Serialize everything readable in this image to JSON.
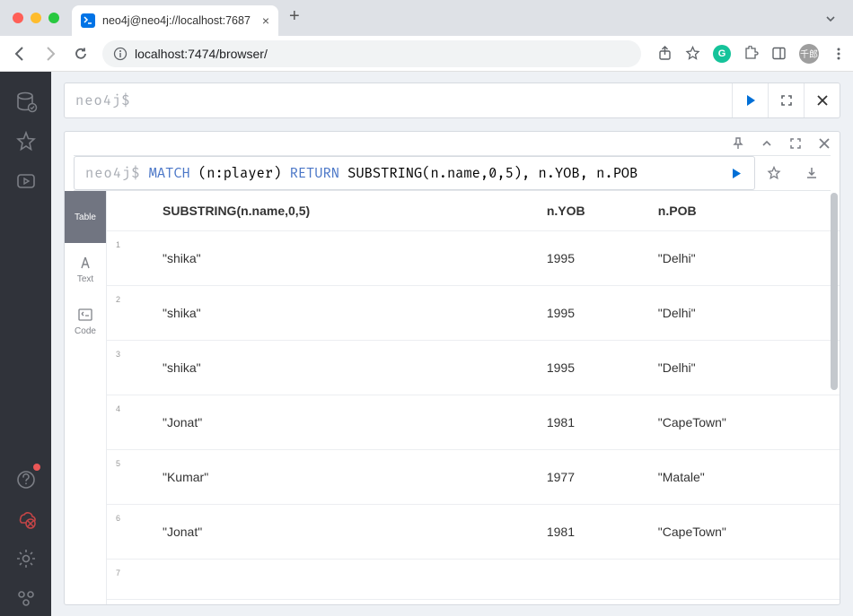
{
  "browser": {
    "tab_title": "neo4j@neo4j://localhost:7687",
    "url": "localhost:7474/browser/",
    "avatar_text": "千郎"
  },
  "editor": {
    "prompt": "neo4j$"
  },
  "result": {
    "prompt": "neo4j$",
    "query_prefix": "MATCH",
    "query_mid1": " (n:player) ",
    "query_kw2": "RETURN",
    "query_rest": " SUBSTRING(n.name,0,5), n.YOB, n.POB",
    "view_tabs": {
      "table": "Table",
      "text": "Text",
      "code": "Code"
    },
    "columns": [
      "SUBSTRING(n.name,0,5)",
      "n.YOB",
      "n.POB"
    ],
    "rows": [
      {
        "idx": "1",
        "c0": "\"shika\"",
        "c1": "1995",
        "c2": "\"Delhi\""
      },
      {
        "idx": "2",
        "c0": "\"shika\"",
        "c1": "1995",
        "c2": "\"Delhi\""
      },
      {
        "idx": "3",
        "c0": "\"shika\"",
        "c1": "1995",
        "c2": "\"Delhi\""
      },
      {
        "idx": "4",
        "c0": "\"Jonat\"",
        "c1": "1981",
        "c2": "\"CapeTown\""
      },
      {
        "idx": "5",
        "c0": "\"Kumar\"",
        "c1": "1977",
        "c2": "\"Matale\""
      },
      {
        "idx": "6",
        "c0": "\"Jonat\"",
        "c1": "1981",
        "c2": "\"CapeTown\""
      },
      {
        "idx": "7",
        "c0": "",
        "c1": "",
        "c2": ""
      }
    ]
  }
}
